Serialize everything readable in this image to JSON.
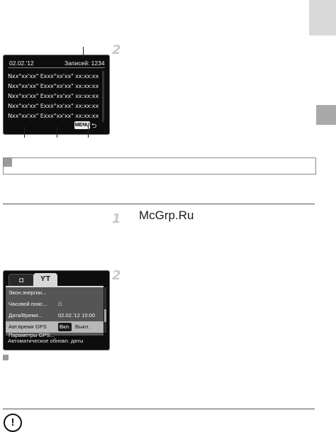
{
  "step_numbers": {
    "step1_top": "2",
    "step_mid": "1",
    "step2_bottom": "2"
  },
  "gps_log_screen": {
    "date": "02.02.'12",
    "records": "Записей: 1234",
    "rows": [
      "Nxx°xx'xx\" Exxx°xx'xx\" xx:xx:xx",
      "Nxx°xx'xx\" Exxx°xx'xx\" xx:xx:xx",
      "Nxx°xx'xx\" Exxx°xx'xx\" xx:xx:xx",
      "Nxx°xx'xx\" Exxx°xx'xx\" xx:xx:xx",
      "Nxx°xx'xx\" Exxx°xx'xx\" xx:xx:xx"
    ],
    "menu_button": "MENU",
    "back_icon": "return-arrow-icon"
  },
  "watermark": "McGrp.Ru",
  "settings_screen": {
    "camera_tab_icon": "camera-icon",
    "tools_tab_icon": "wrench-hammer-icon",
    "tools_tab_glyph": "ƳT",
    "items": [
      {
        "label": "Экон.энергии...",
        "value": ""
      },
      {
        "label": "Часовой пояс...",
        "value": ""
      },
      {
        "label": "Дата/Время...",
        "value": "02.02.'12 10:00"
      },
      {
        "label": "Авт.время GPS",
        "value": ""
      },
      {
        "label": "Параметры GPS...",
        "value": ""
      }
    ],
    "home_icon": "home-icon",
    "selected_on": "Вкл.",
    "selected_off": "Выкл.",
    "description": "Автоматическое обновл. даты"
  },
  "warning_icon": "!"
}
